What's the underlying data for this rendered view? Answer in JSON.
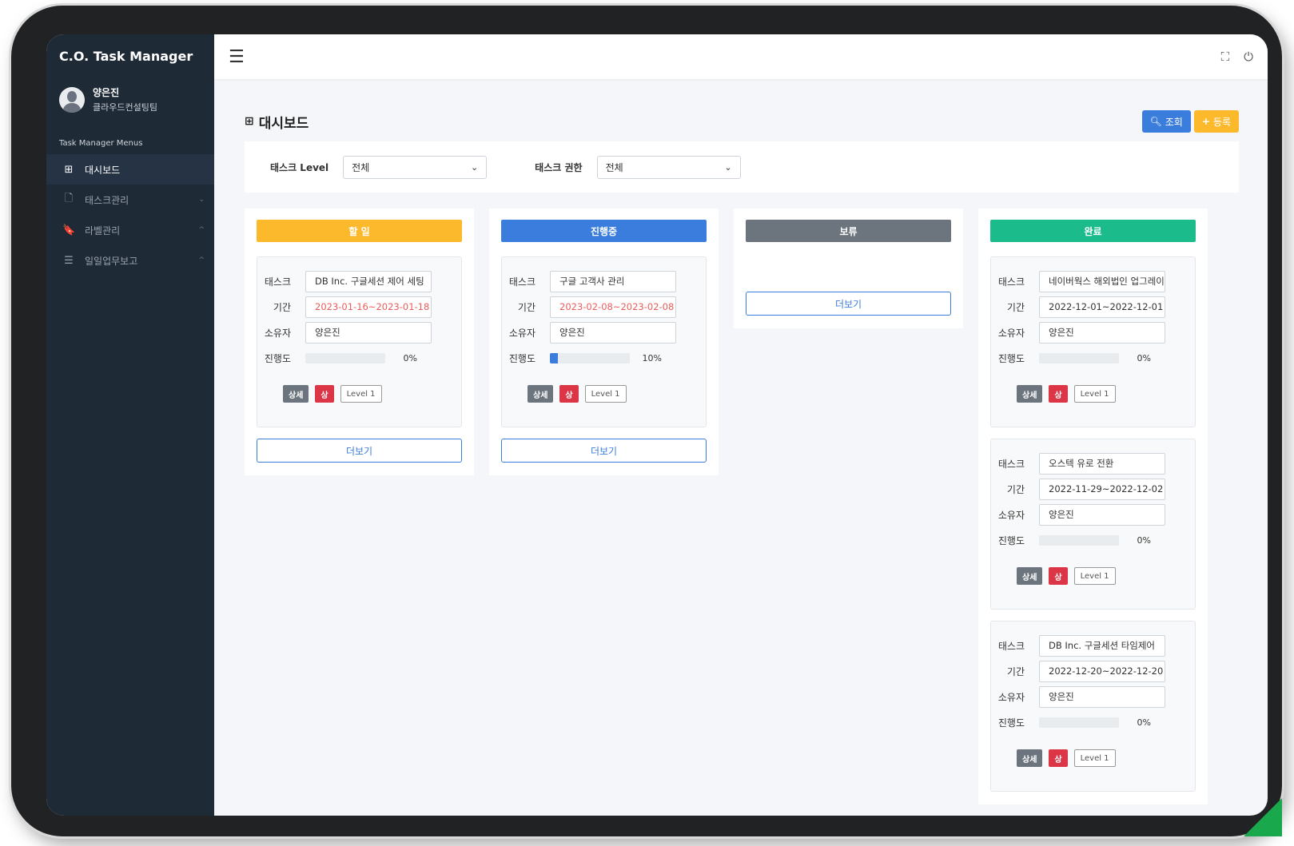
{
  "app": {
    "title": "C.O. Task Manager"
  },
  "user": {
    "name": "양은진",
    "team": "클라우드컨설팅팀"
  },
  "sidebar": {
    "header": "Task Manager Menus",
    "items": [
      {
        "label": "대시보드",
        "icon": "⊞",
        "chev": ""
      },
      {
        "label": "태스크관리",
        "icon": "🗋",
        "chev": "⌄"
      },
      {
        "label": "라벨관리",
        "icon": "🔖",
        "chev": "^"
      },
      {
        "label": "일일업무보고",
        "icon": "☰",
        "chev": "^"
      }
    ]
  },
  "topbar": {
    "menu_icon": "☰",
    "fullscreen_icon": "⛶",
    "power_icon": "⏻"
  },
  "page": {
    "title": "대시보드",
    "title_icon": "⊞",
    "search_label": "조회",
    "add_label": "등록"
  },
  "filters": {
    "level_label": "태스크 Level",
    "level_value": "전체",
    "role_label": "태스크 권한",
    "role_value": "전체"
  },
  "labels": {
    "task": "태스크",
    "period": "기간",
    "owner": "소유자",
    "progress": "진행도",
    "detail": "상세",
    "more": "더보기"
  },
  "columns": [
    {
      "title": "할 일",
      "color": "#fcb92c",
      "tasks": [
        {
          "task": "DB Inc. 구글세션 제어 세팅",
          "period": "2023-01-16~2023-01-18",
          "overdue": true,
          "owner": "양은진",
          "progress": 0,
          "progress_text": "0%",
          "priority": "상",
          "level": "Level 1"
        }
      ]
    },
    {
      "title": "진행중",
      "color": "#3b7ddd",
      "tasks": [
        {
          "task": "구글 고객사 관리",
          "period": "2023-02-08~2023-02-08",
          "overdue": true,
          "owner": "양은진",
          "progress": 10,
          "progress_text": "10%",
          "priority": "상",
          "level": "Level 1"
        }
      ]
    },
    {
      "title": "보류",
      "color": "#6c757d",
      "tasks": []
    },
    {
      "title": "완료",
      "color": "#1cbb8c",
      "tasks": [
        {
          "task": "네이버웍스 해외법인 업그레이드",
          "period": "2022-12-01~2022-12-01",
          "overdue": false,
          "owner": "양은진",
          "progress": 0,
          "progress_text": "0%",
          "priority": "상",
          "level": "Level 1"
        },
        {
          "task": "오스텍 유로 전환",
          "period": "2022-11-29~2022-12-02",
          "overdue": false,
          "owner": "양은진",
          "progress": 0,
          "progress_text": "0%",
          "priority": "상",
          "level": "Level 1"
        },
        {
          "task": "DB Inc. 구글세션 타임제어",
          "period": "2022-12-20~2022-12-20",
          "overdue": false,
          "owner": "양은진",
          "progress": 0,
          "progress_text": "0%",
          "priority": "상",
          "level": "Level 1"
        }
      ]
    }
  ]
}
